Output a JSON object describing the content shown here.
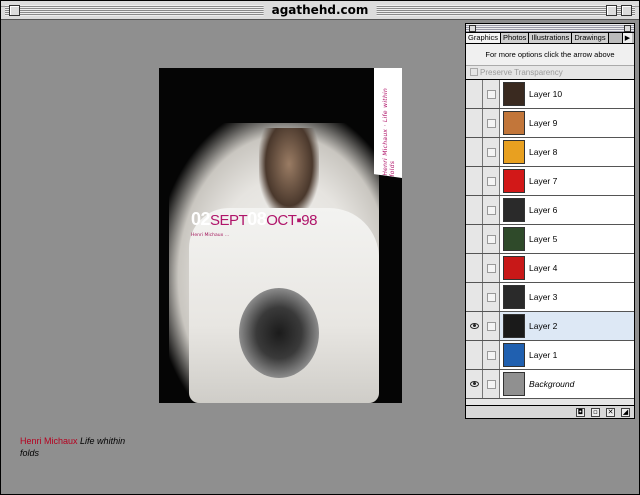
{
  "window": {
    "title": "agathehd.com"
  },
  "poster": {
    "dates_parts": [
      "02",
      "SEPT",
      "08",
      "OCT",
      "98"
    ],
    "vertical_text": "Henri Michaux · Life within folds",
    "caption_text": "Henri Michaux …"
  },
  "credit": {
    "name": "Henri Michaux",
    "work": "Life whithin folds"
  },
  "palette": {
    "tabs": [
      "Graphics",
      "Photos",
      "Illustrations",
      "Drawings"
    ],
    "hint": "For more options click the arrow above",
    "preserve_transparency": "Preserve Transparency",
    "layers": [
      {
        "name": "Layer 10",
        "thumb_color": "#3a2a20",
        "visible": false,
        "selected": false
      },
      {
        "name": "Layer 9",
        "thumb_color": "#c2763a",
        "visible": false,
        "selected": false
      },
      {
        "name": "Layer 8",
        "thumb_color": "#e8a020",
        "visible": false,
        "selected": false
      },
      {
        "name": "Layer 7",
        "thumb_color": "#d21818",
        "visible": false,
        "selected": false
      },
      {
        "name": "Layer 6",
        "thumb_color": "#2a2a2a",
        "visible": false,
        "selected": false
      },
      {
        "name": "Layer 5",
        "thumb_color": "#2f4a2a",
        "visible": false,
        "selected": false
      },
      {
        "name": "Layer 4",
        "thumb_color": "#c81818",
        "visible": false,
        "selected": false
      },
      {
        "name": "Layer 3",
        "thumb_color": "#2a2a2a",
        "visible": false,
        "selected": false
      },
      {
        "name": "Layer 2",
        "thumb_color": "#1a1a1a",
        "visible": true,
        "selected": true
      },
      {
        "name": "Layer 1",
        "thumb_color": "#2060b0",
        "visible": false,
        "selected": false
      },
      {
        "name": "Background",
        "thumb_color": "#909090",
        "visible": true,
        "selected": false
      }
    ]
  }
}
